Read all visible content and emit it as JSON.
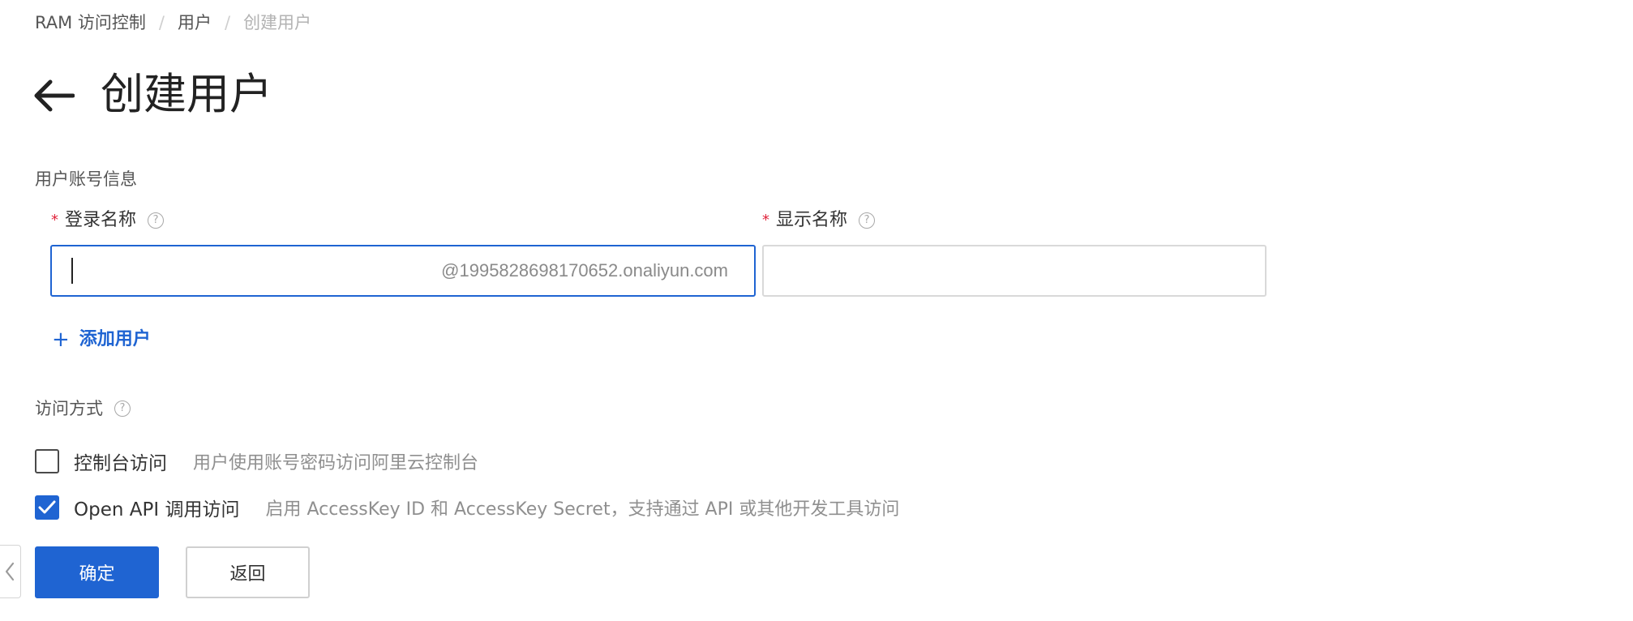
{
  "breadcrumb": {
    "items": [
      "RAM 访问控制",
      "用户",
      "创建用户"
    ],
    "separator": "/"
  },
  "header": {
    "back_icon": "arrow-left-icon",
    "title": "创建用户"
  },
  "account_section": {
    "title": "用户账号信息",
    "login_name": {
      "required_mark": "*",
      "label": "登录名称",
      "help_icon": "question-circle-icon",
      "value": "",
      "suffix": "@1995828698170652.onaliyun.com"
    },
    "display_name": {
      "required_mark": "*",
      "label": "显示名称",
      "help_icon": "question-circle-icon",
      "value": ""
    },
    "add_user_label": "添加用户",
    "add_user_icon": "plus-icon"
  },
  "access_section": {
    "title": "访问方式",
    "help_icon": "question-circle-icon",
    "options": [
      {
        "label": "控制台访问",
        "description": "用户使用账号密码访问阿里云控制台",
        "checked": false
      },
      {
        "label": "Open API 调用访问",
        "description": "启用 AccessKey ID 和 AccessKey Secret，支持通过 API 或其他开发工具访问",
        "checked": true
      }
    ]
  },
  "actions": {
    "confirm_label": "确定",
    "back_label": "返回"
  },
  "side_toggle_icon": "chevron-left-icon",
  "colors": {
    "primary": "#1f64d2",
    "required": "#e0243b",
    "muted_text": "#8f8f8f"
  }
}
